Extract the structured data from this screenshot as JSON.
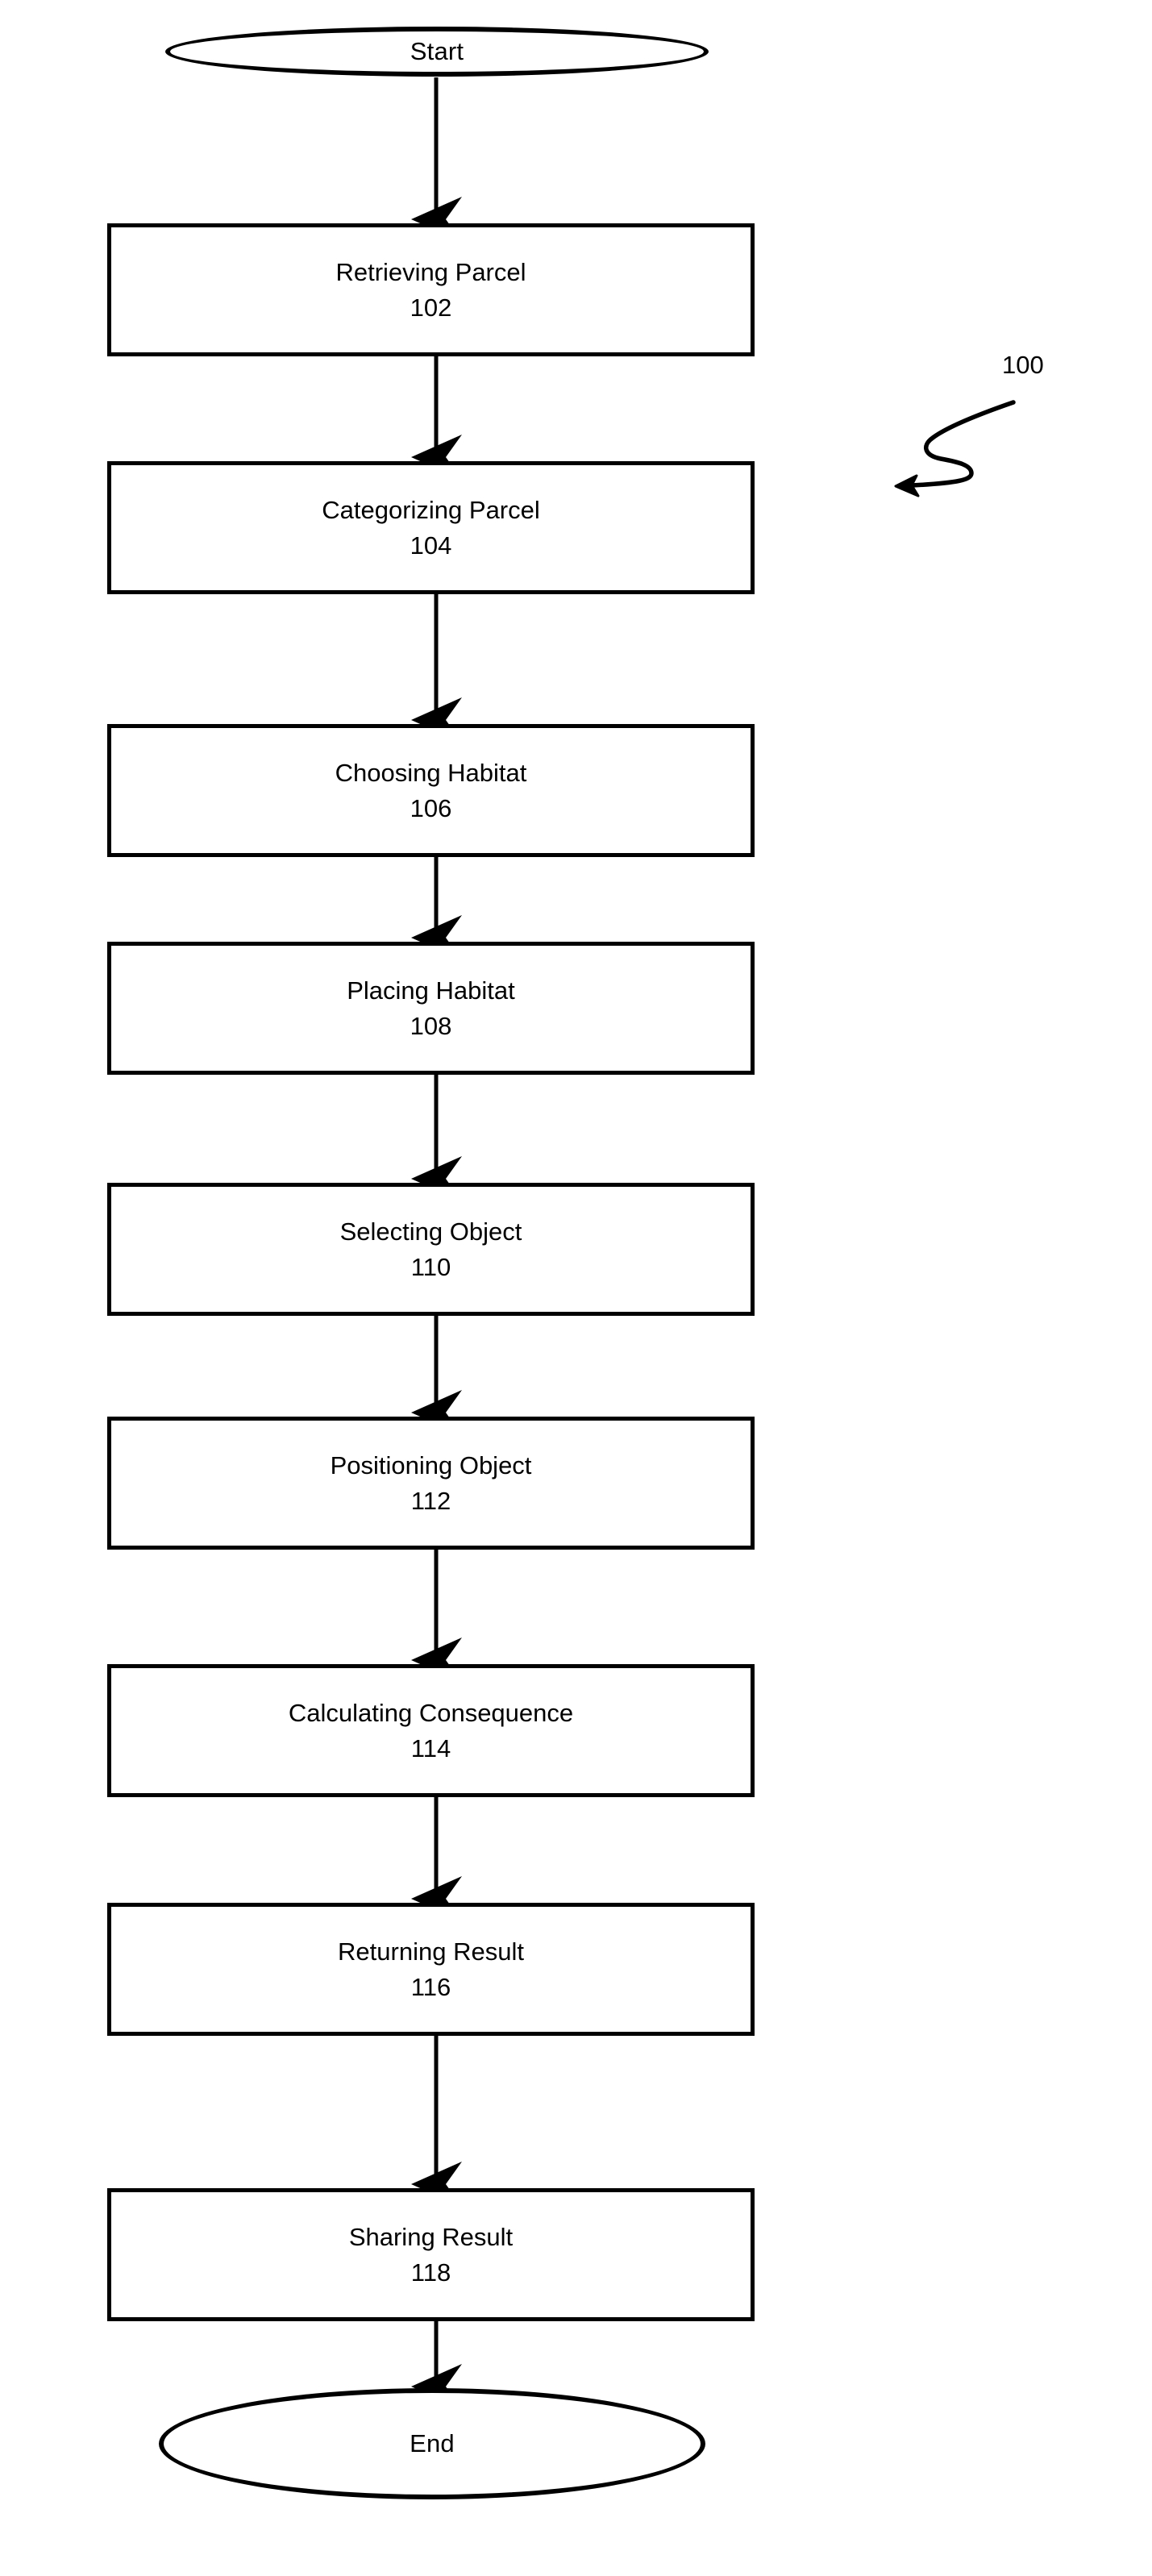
{
  "figure": {
    "reference_number": "100",
    "reference_arrow_icon": "curly-pointer-arrow-icon",
    "background_color": "#ffffff",
    "line_color": "#000000"
  },
  "flowchart": {
    "orientation": "top-to-bottom",
    "start": {
      "shape": "ellipse",
      "label": "Start"
    },
    "end": {
      "shape": "ellipse",
      "label": "End"
    },
    "steps": [
      {
        "shape": "rectangle",
        "label": "Retrieving Parcel",
        "ref": "102"
      },
      {
        "shape": "rectangle",
        "label": "Categorizing Parcel",
        "ref": "104"
      },
      {
        "shape": "rectangle",
        "label": "Choosing Habitat",
        "ref": "106"
      },
      {
        "shape": "rectangle",
        "label": "Placing Habitat",
        "ref": "108"
      },
      {
        "shape": "rectangle",
        "label": "Selecting Object",
        "ref": "110"
      },
      {
        "shape": "rectangle",
        "label": "Positioning Object",
        "ref": "112"
      },
      {
        "shape": "rectangle",
        "label": "Calculating Consequence",
        "ref": "114"
      },
      {
        "shape": "rectangle",
        "label": "Returning Result",
        "ref": "116"
      },
      {
        "shape": "rectangle",
        "label": "Sharing Result",
        "ref": "118"
      }
    ],
    "connectors": [
      {
        "from": "Start",
        "to": "Retrieving Parcel",
        "arrow": "down-arrow-icon"
      },
      {
        "from": "Retrieving Parcel",
        "to": "Categorizing Parcel",
        "arrow": "down-arrow-icon"
      },
      {
        "from": "Categorizing Parcel",
        "to": "Choosing Habitat",
        "arrow": "down-arrow-icon"
      },
      {
        "from": "Choosing Habitat",
        "to": "Placing Habitat",
        "arrow": "down-arrow-icon"
      },
      {
        "from": "Placing Habitat",
        "to": "Selecting Object",
        "arrow": "down-arrow-icon"
      },
      {
        "from": "Selecting Object",
        "to": "Positioning Object",
        "arrow": "down-arrow-icon"
      },
      {
        "from": "Positioning Object",
        "to": "Calculating Consequence",
        "arrow": "down-arrow-icon"
      },
      {
        "from": "Calculating Consequence",
        "to": "Returning Result",
        "arrow": "down-arrow-icon"
      },
      {
        "from": "Returning Result",
        "to": "Sharing Result",
        "arrow": "down-arrow-icon"
      },
      {
        "from": "Sharing Result",
        "to": "End",
        "arrow": "down-arrow-icon"
      }
    ]
  }
}
